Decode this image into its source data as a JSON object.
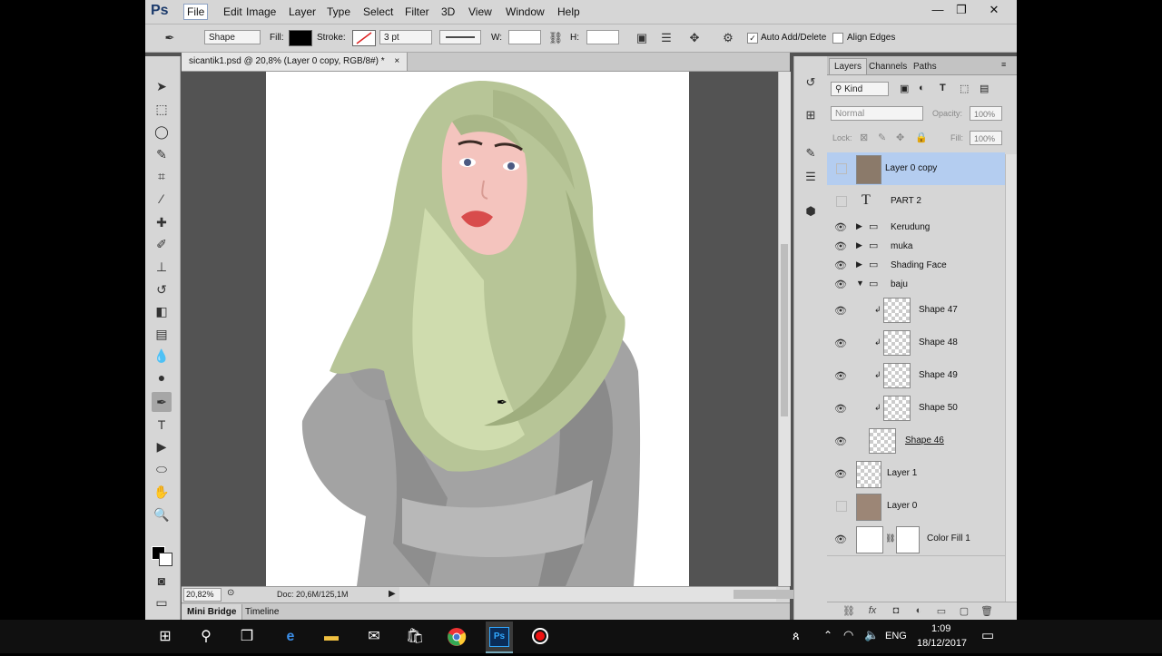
{
  "app": {
    "logo": "Ps"
  },
  "menu": [
    "File",
    "Edit",
    "Image",
    "Layer",
    "Type",
    "Select",
    "Filter",
    "3D",
    "View",
    "Window",
    "Help"
  ],
  "window_buttons": [
    "—",
    "❐",
    "✕"
  ],
  "options": {
    "mode": "Shape",
    "fill_label": "Fill:",
    "stroke_label": "Stroke:",
    "stroke_width": "3 pt",
    "w_label": "W:",
    "h_label": "H:",
    "auto_add_delete": "Auto Add/Delete",
    "align_edges": "Align Edges"
  },
  "document": {
    "tab_title": "sicantik1.psd @ 20,8% (Layer 0 copy, RGB/8#) *",
    "close": "×",
    "zoom": "20,82%",
    "doc_size": "Doc: 20,6M/125,1M"
  },
  "bottom_tabs": [
    "Mini Bridge",
    "Timeline"
  ],
  "panel": {
    "tabs": [
      "Layers",
      "Channels",
      "Paths"
    ],
    "filter_kind": "Kind",
    "blend_mode": "Normal",
    "opacity_label": "Opacity:",
    "opacity": "100%",
    "lock_label": "Lock:",
    "fill_label": "Fill:",
    "fill": "100%"
  },
  "layers": [
    {
      "name": "Layer 0 copy"
    },
    {
      "name": "PART 2"
    },
    {
      "name": "Kerudung"
    },
    {
      "name": "muka"
    },
    {
      "name": "Shading Face"
    },
    {
      "name": "baju"
    },
    {
      "name": "Shape 47"
    },
    {
      "name": "Shape 48"
    },
    {
      "name": "Shape 49"
    },
    {
      "name": "Shape 50"
    },
    {
      "name": "Shape 46"
    },
    {
      "name": "Layer 1"
    },
    {
      "name": "Layer 0"
    },
    {
      "name": "Color Fill 1"
    }
  ],
  "taskbar": {
    "lang": "ENG",
    "time": "1:09",
    "date": "18/12/2017",
    "apps": [
      "Ps"
    ]
  },
  "colors": {
    "accent_selected": "#b4cdf0",
    "hijab": "#b9c79a",
    "jacket": "#a9a9a9"
  }
}
